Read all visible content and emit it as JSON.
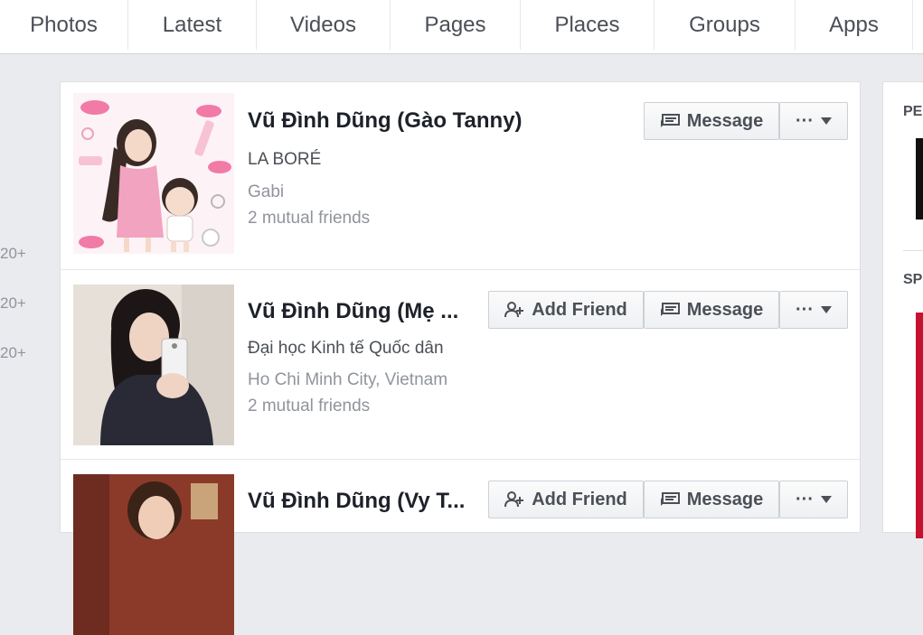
{
  "tabs": [
    "Photos",
    "Latest",
    "Videos",
    "Pages",
    "Places",
    "Groups",
    "Apps"
  ],
  "left_counts": [
    "20+",
    "20+",
    "20+"
  ],
  "results": [
    {
      "name": "Vũ Đình Dũng (Gào Tanny)",
      "line1": "LA BORÉ",
      "line2": "Gabi",
      "line3": "2 mutual friends",
      "add_friend": null,
      "message": "Message",
      "more": "···"
    },
    {
      "name": "Vũ Đình Dũng (Mẹ ...",
      "line1": "Đại học Kinh tế Quốc dân",
      "line2": "Ho Chi Minh City, Vietnam",
      "line3": "2 mutual friends",
      "add_friend": "Add Friend",
      "message": "Message",
      "more": "···"
    },
    {
      "name": "Vũ Đình Dũng (Vy T...",
      "add_friend": "Add Friend",
      "message": "Message",
      "more": "···"
    }
  ],
  "sidebar": {
    "label1": "PE",
    "label2": "SP"
  },
  "colors": {
    "background": "#e9ebee",
    "name_text": "#1d2129",
    "muted_text": "#90949c",
    "button_border": "#ccd0d5",
    "accent_red": "#c4122f"
  }
}
